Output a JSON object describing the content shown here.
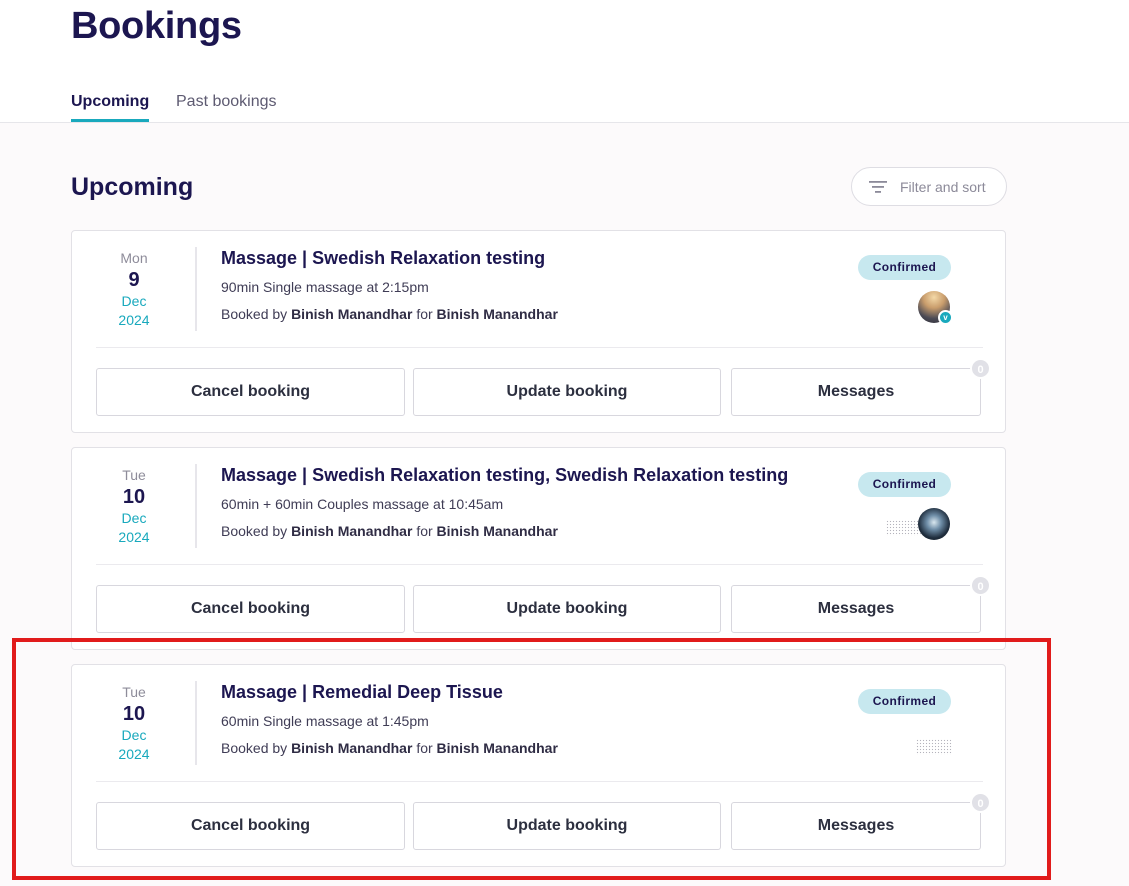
{
  "page": {
    "title": "Bookings"
  },
  "tabs": [
    {
      "label": "Upcoming",
      "active": true
    },
    {
      "label": "Past bookings",
      "active": false
    }
  ],
  "section": {
    "title": "Upcoming",
    "filter_label": "Filter and sort"
  },
  "colors": {
    "accent": "#19a9bd",
    "heading": "#1c1650",
    "badge_bg": "#c7e8ef",
    "highlight": "#e11b1b"
  },
  "bookings": [
    {
      "dow": "Mon",
      "day": "9",
      "month": "Dec",
      "year": "2024",
      "title": "Massage | Swedish Relaxation testing",
      "detail": "90min Single massage at 2:15pm",
      "booked_by_prefix": "Booked by",
      "booked_by": "Binish Manandhar",
      "for_word": "for",
      "booked_for": "Binish Manandhar",
      "status": "Confirmed",
      "avatar_badge": "v",
      "actions": {
        "cancel": "Cancel booking",
        "update": "Update booking",
        "messages": "Messages"
      },
      "message_count": "0"
    },
    {
      "dow": "Tue",
      "day": "10",
      "month": "Dec",
      "year": "2024",
      "title": "Massage | Swedish Relaxation testing, Swedish Relaxation testing",
      "detail": "60min + 60min Couples massage at 10:45am",
      "booked_by_prefix": "Booked by",
      "booked_by": "Binish Manandhar",
      "for_word": "for",
      "booked_for": "Binish Manandhar",
      "status": "Confirmed",
      "actions": {
        "cancel": "Cancel booking",
        "update": "Update booking",
        "messages": "Messages"
      },
      "message_count": "0"
    },
    {
      "dow": "Tue",
      "day": "10",
      "month": "Dec",
      "year": "2024",
      "title": "Massage | Remedial Deep Tissue",
      "detail": "60min Single massage at 1:45pm",
      "booked_by_prefix": "Booked by",
      "booked_by": "Binish Manandhar",
      "for_word": "for",
      "booked_for": "Binish Manandhar",
      "status": "Confirmed",
      "actions": {
        "cancel": "Cancel booking",
        "update": "Update booking",
        "messages": "Messages"
      },
      "message_count": "0"
    }
  ]
}
